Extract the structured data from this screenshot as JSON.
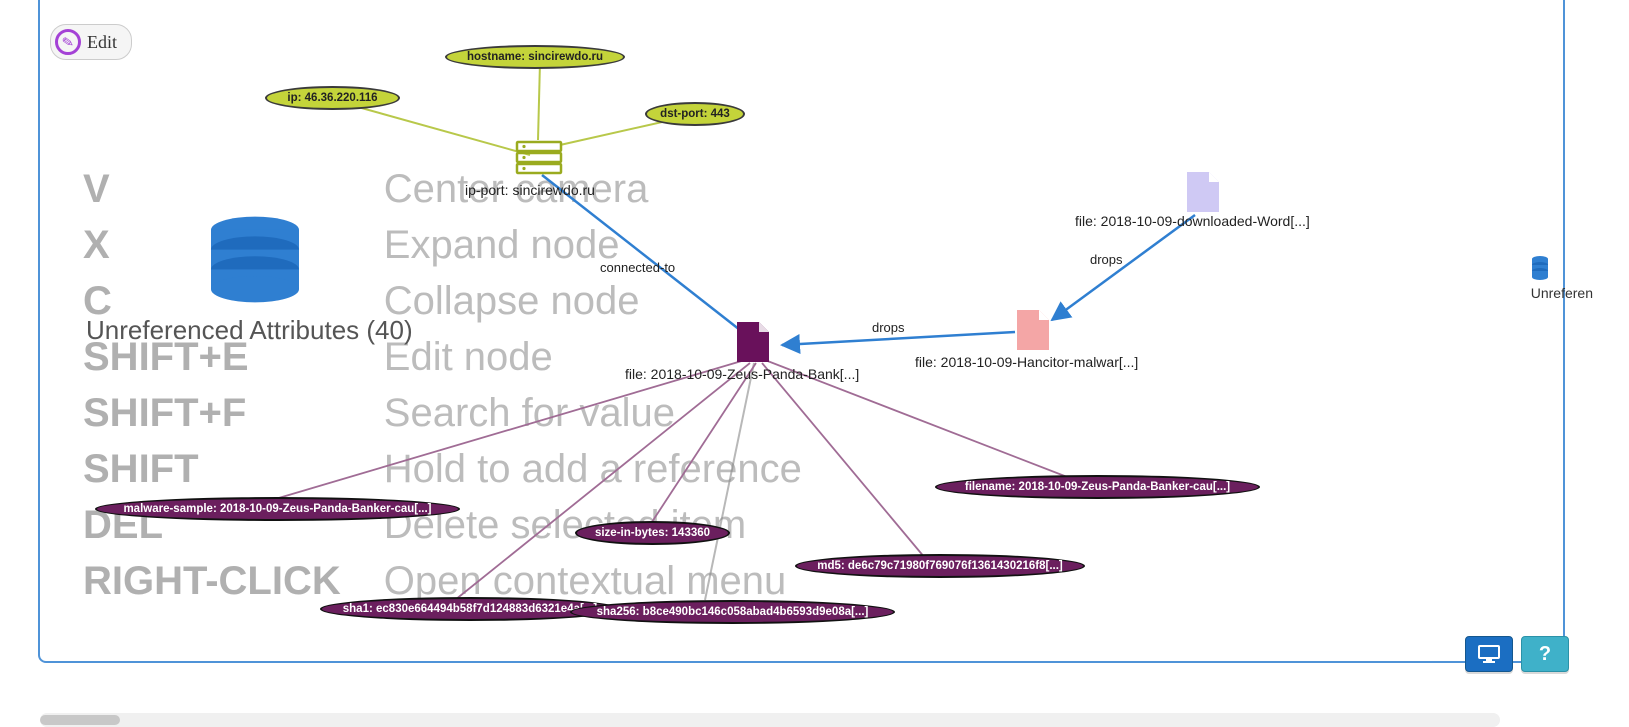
{
  "edit_button": {
    "label": "Edit"
  },
  "unref_panel": {
    "label": "Unreferenced Attributes (40)"
  },
  "right_stub": {
    "label": "Unreferen"
  },
  "shortcuts": [
    {
      "key": "V",
      "desc": "Center camera"
    },
    {
      "key": "X",
      "desc": "Expand node"
    },
    {
      "key": "C",
      "desc": "Collapse node"
    },
    {
      "key": "SHIFT+E",
      "desc": "Edit node"
    },
    {
      "key": "SHIFT+F",
      "desc": "Search for value"
    },
    {
      "key": "SHIFT",
      "desc": "Hold to add a reference"
    },
    {
      "key": "DEL",
      "desc": "Delete selected item"
    },
    {
      "key": "RIGHT-CLICK",
      "desc": "Open contextual menu"
    }
  ],
  "buttons": {
    "help": "?"
  },
  "graph": {
    "relations": {
      "drops1": "drops",
      "drops2": "drops",
      "connected": "connected-to"
    },
    "objects": {
      "ipport": {
        "label": "ip-port: sincirewdo.ru"
      },
      "zeus": {
        "label": "file: 2018-10-09-Zeus-Panda-Bank[...]"
      },
      "hancitor": {
        "label": "file: 2018-10-09-Hancitor-malwar[...]"
      },
      "word": {
        "label": "file: 2018-10-09-downloaded-Word[...]"
      }
    },
    "attributes": {
      "ip": {
        "label": "ip: 46.36.220.116"
      },
      "hostname": {
        "label": "hostname: sincirewdo.ru"
      },
      "dstport": {
        "label": "dst-port: 443"
      },
      "malware": {
        "label": "malware-sample: 2018-10-09-Zeus-Panda-Banker-cau[...]"
      },
      "size": {
        "label": "size-in-bytes: 143360"
      },
      "filename": {
        "label": "filename: 2018-10-09-Zeus-Panda-Banker-cau[...]"
      },
      "md5": {
        "label": "md5: de6c79c71980f769076f1361430216f8[...]"
      },
      "sha1": {
        "label": "sha1: ec830e664494b58f7d124883d6321e4a[...]"
      },
      "sha256": {
        "label": "sha256: b8ce490bc146c058abad4b6593d9e08a[...]"
      }
    }
  }
}
